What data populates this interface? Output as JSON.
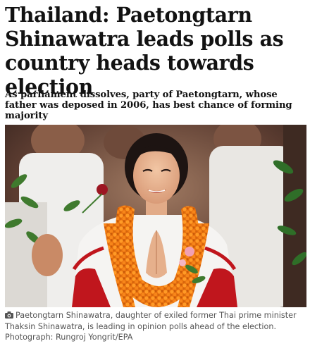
{
  "article": {
    "headline": "Thailand: Paetongtarn Shinawatra leads polls as country heads towards election",
    "standfirst": "As parliament dissolves, party of Paetongtarn, whose father was deposed in 2006, has best chance of forming majority",
    "photo": {
      "caption": "Paetongtarn Shinawatra, daughter of exiled former Thai prime minister Thaksin Shinawatra, is leading in opinion polls ahead of the election.",
      "credit": "Photograph: Rungroj Yongrit/EPA",
      "caption_icon": "camera-icon"
    }
  },
  "colors": {
    "text": "#121212",
    "caption": "#545454",
    "garland": "#f07a12",
    "jacket_red": "#c0161d"
  }
}
